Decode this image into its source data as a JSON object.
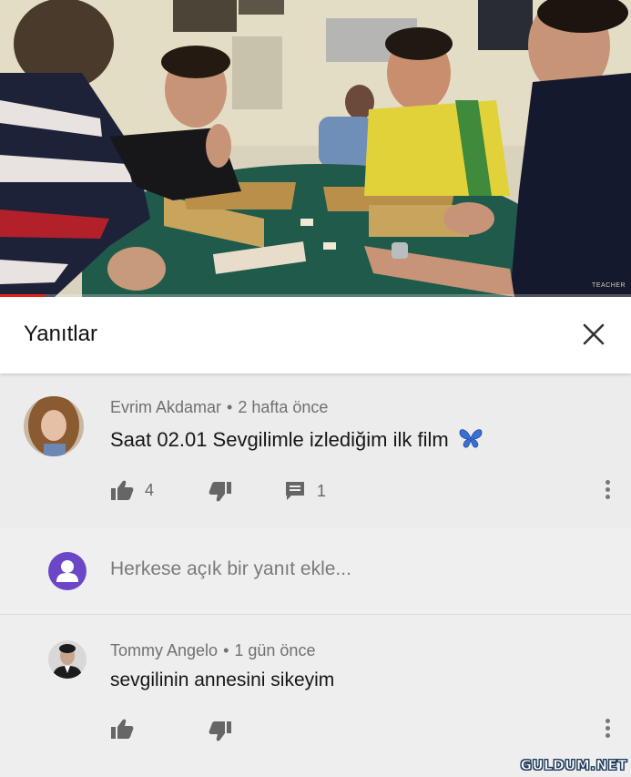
{
  "video": {
    "progress_fraction": 0.07,
    "channel_watermark": "TEACHER"
  },
  "panel": {
    "title": "Yanıtlar",
    "close_icon": "close-icon"
  },
  "comments": [
    {
      "author": "Evrim Akdamar",
      "separator": "•",
      "time": "2 hafta önce",
      "text": "Saat 02.01 Sevgilimle izlediğim ilk film",
      "emoji_icon": "butterfly-icon",
      "likes": "4",
      "replies": "1"
    }
  ],
  "reply_input": {
    "placeholder": "Herkese açık bir yanıt ekle..."
  },
  "replies": [
    {
      "author": "Tommy Angelo",
      "separator": "•",
      "time": "1 gün önce",
      "text": "sevgilinin annesini sikeyim"
    }
  ],
  "watermark": "GULDUM.NET",
  "colors": {
    "progress": "#e62117",
    "user_avatar": "#6b47c7",
    "butterfly": "#3b6fd6"
  }
}
